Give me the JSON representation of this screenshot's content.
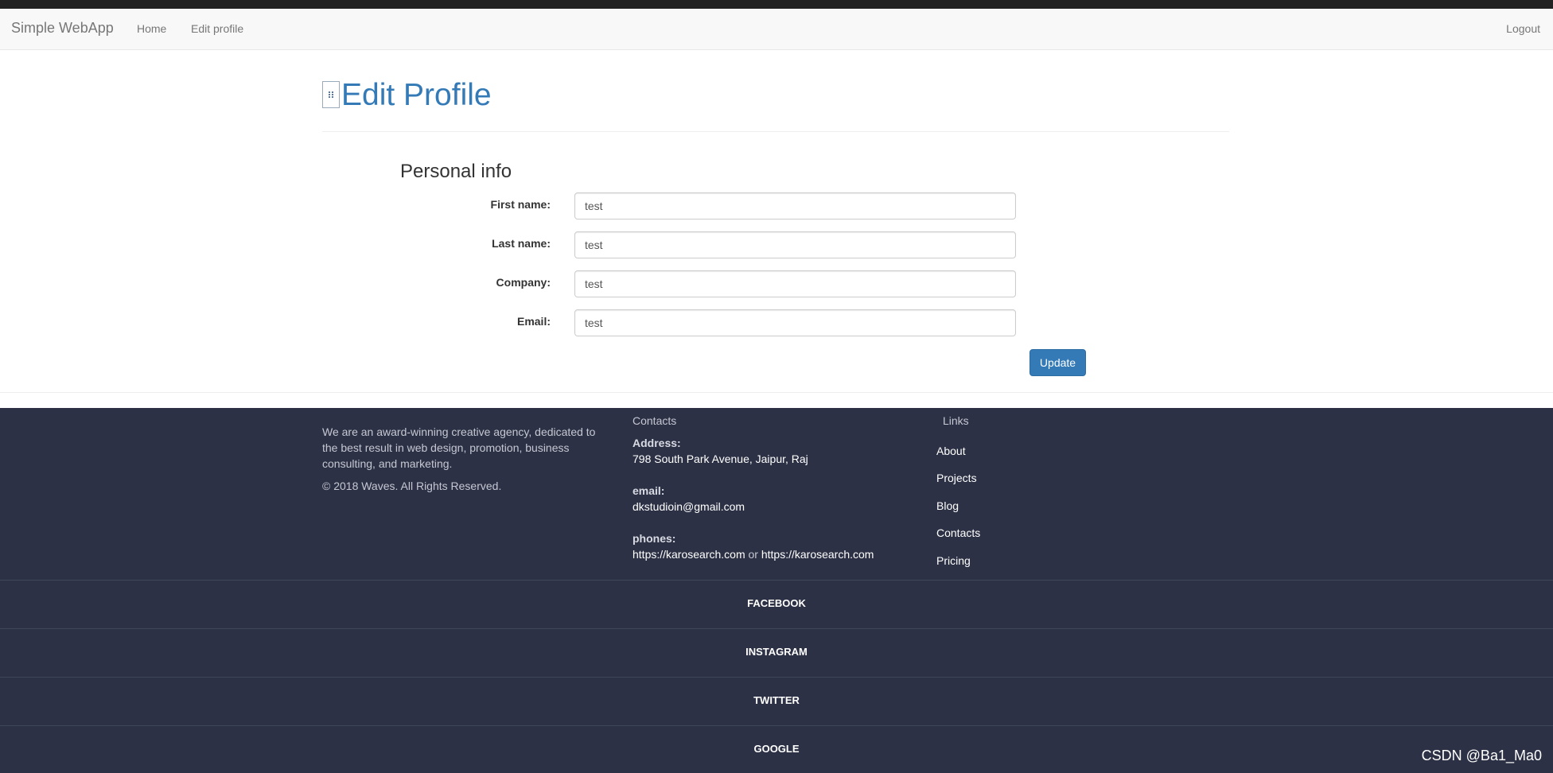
{
  "navbar": {
    "brand": "Simple WebApp",
    "home_label": "Home",
    "edit_label": "Edit profile",
    "logout_label": "Logout"
  },
  "header": {
    "title": "Edit Profile"
  },
  "form": {
    "section_title": "Personal info",
    "fields": [
      {
        "label": "First name:",
        "value": "test"
      },
      {
        "label": "Last name:",
        "value": "test"
      },
      {
        "label": "Company:",
        "value": "test"
      },
      {
        "label": "Email:",
        "value": "test"
      }
    ],
    "update_label": "Update"
  },
  "footer": {
    "about": "We are an award-winning creative agency, dedicated to the best result in web design, promotion, business consulting, and marketing.",
    "copyright": "© 2018 Waves. All Rights Reserved.",
    "contacts": {
      "heading": "Contacts",
      "address_label": "Address:",
      "address": "798 South Park Avenue, Jaipur, Raj",
      "email_label": "email:",
      "email": "dkstudioin@gmail.com",
      "phones_label": "phones:",
      "phone1": "https://karosearch.com",
      "or_text": "or",
      "phone2": "https://karosearch.com"
    },
    "links": {
      "heading": "Links",
      "items": [
        "About",
        "Projects",
        "Blog",
        "Contacts",
        "Pricing"
      ]
    },
    "social": [
      "FACEBOOK",
      "INSTAGRAM",
      "TWITTER",
      "GOOGLE"
    ]
  },
  "watermark": "CSDN @Ba1_Ma0",
  "colors": {
    "accent": "#337ab7",
    "footer_bg": "#2c3145",
    "navbar_bg": "#f8f8f8"
  }
}
